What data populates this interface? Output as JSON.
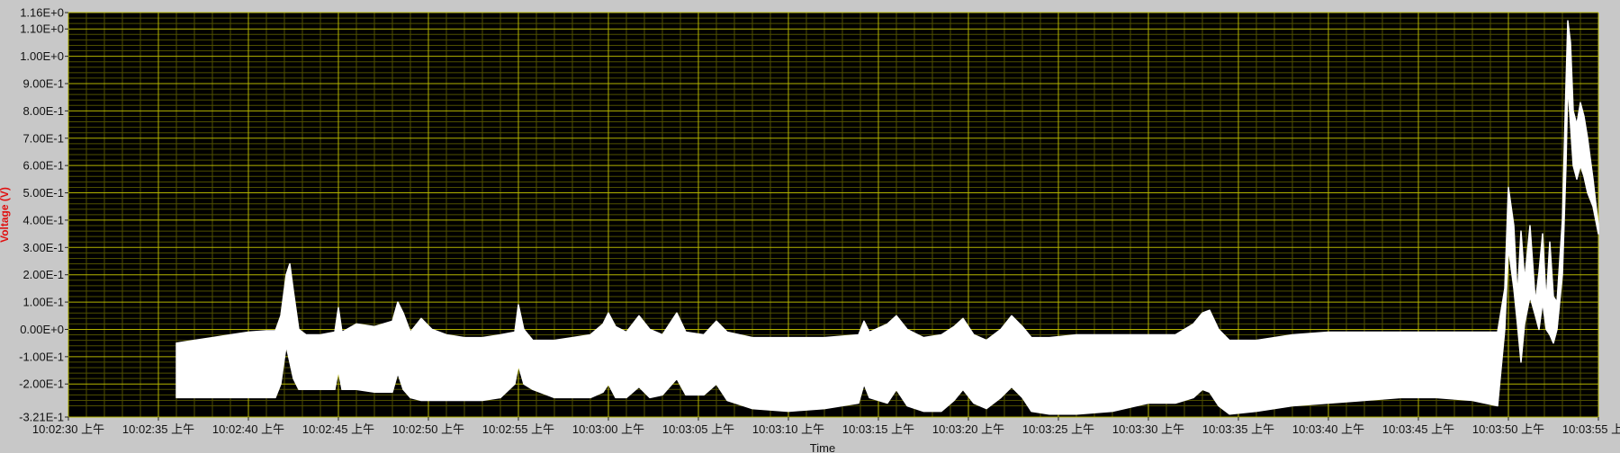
{
  "chart_data": {
    "type": "line",
    "title": "",
    "xlabel": "Time",
    "ylabel": "Voltage (V)",
    "ylim": [
      -0.321,
      1.16
    ],
    "xlim_seconds": [
      0,
      85
    ],
    "grid": true,
    "colors": {
      "plot_background": "#000000",
      "major_grid": "#b4b400",
      "minor_grid": "#4f4f00",
      "series": "#ffffff",
      "frame": "#c8c8c8",
      "ylabel": "#e01010"
    },
    "y_ticks": [
      {
        "value": 1.16,
        "label": "1.16E+0"
      },
      {
        "value": 1.1,
        "label": "1.10E+0"
      },
      {
        "value": 1.0,
        "label": "1.00E+0"
      },
      {
        "value": 0.9,
        "label": "9.00E-1"
      },
      {
        "value": 0.8,
        "label": "8.00E-1"
      },
      {
        "value": 0.7,
        "label": "7.00E-1"
      },
      {
        "value": 0.6,
        "label": "6.00E-1"
      },
      {
        "value": 0.5,
        "label": "5.00E-1"
      },
      {
        "value": 0.4,
        "label": "4.00E-1"
      },
      {
        "value": 0.3,
        "label": "3.00E-1"
      },
      {
        "value": 0.2,
        "label": "2.00E-1"
      },
      {
        "value": 0.1,
        "label": "1.00E-1"
      },
      {
        "value": 0.0,
        "label": "0.00E+0"
      },
      {
        "value": -0.1,
        "label": "-1.00E-1"
      },
      {
        "value": -0.2,
        "label": "-2.00E-1"
      },
      {
        "value": -0.321,
        "label": "-3.21E-1"
      }
    ],
    "x_ticks": [
      {
        "t": 0,
        "label": "10:02:30 上午"
      },
      {
        "t": 5,
        "label": "10:02:35 上午"
      },
      {
        "t": 10,
        "label": "10:02:40 上午"
      },
      {
        "t": 15,
        "label": "10:02:45 上午"
      },
      {
        "t": 20,
        "label": "10:02:50 上午"
      },
      {
        "t": 25,
        "label": "10:02:55 上午"
      },
      {
        "t": 30,
        "label": "10:03:00 上午"
      },
      {
        "t": 35,
        "label": "10:03:05 上午"
      },
      {
        "t": 40,
        "label": "10:03:10 上午"
      },
      {
        "t": 45,
        "label": "10:03:15 上午"
      },
      {
        "t": 50,
        "label": "10:03:20 上午"
      },
      {
        "t": 55,
        "label": "10:03:25 上午"
      },
      {
        "t": 60,
        "label": "10:03:30 上午"
      },
      {
        "t": 65,
        "label": "10:03:35 上午"
      },
      {
        "t": 70,
        "label": "10:03:40 上午"
      },
      {
        "t": 75,
        "label": "10:03:45 上午"
      },
      {
        "t": 80,
        "label": "10:03:50 上午"
      },
      {
        "t": 85,
        "label": "10:03:55 上午"
      }
    ],
    "series": [
      {
        "upper": [
          [
            6.0,
            -0.05
          ],
          [
            7.0,
            -0.04
          ],
          [
            8.0,
            -0.03
          ],
          [
            9.0,
            -0.02
          ],
          [
            10.0,
            -0.01
          ],
          [
            11.0,
            -0.005
          ],
          [
            11.5,
            -0.005
          ],
          [
            11.8,
            0.05
          ],
          [
            12.1,
            0.2
          ],
          [
            12.3,
            0.24
          ],
          [
            12.5,
            0.14
          ],
          [
            12.8,
            0.0
          ],
          [
            13.2,
            -0.02
          ],
          [
            14.0,
            -0.02
          ],
          [
            14.8,
            -0.01
          ],
          [
            15.0,
            0.08
          ],
          [
            15.2,
            -0.01
          ],
          [
            16.0,
            0.02
          ],
          [
            17.0,
            0.01
          ],
          [
            18.0,
            0.03
          ],
          [
            18.3,
            0.1
          ],
          [
            18.6,
            0.06
          ],
          [
            19.0,
            -0.01
          ],
          [
            19.6,
            0.04
          ],
          [
            20.2,
            0.0
          ],
          [
            21.0,
            -0.02
          ],
          [
            22.0,
            -0.03
          ],
          [
            23.0,
            -0.03
          ],
          [
            24.0,
            -0.02
          ],
          [
            24.8,
            -0.01
          ],
          [
            25.0,
            0.09
          ],
          [
            25.3,
            0.0
          ],
          [
            25.8,
            -0.04
          ],
          [
            27.0,
            -0.04
          ],
          [
            28.0,
            -0.03
          ],
          [
            29.0,
            -0.02
          ],
          [
            29.7,
            0.02
          ],
          [
            30.0,
            0.06
          ],
          [
            30.4,
            0.01
          ],
          [
            31.0,
            -0.01
          ],
          [
            31.7,
            0.05
          ],
          [
            32.3,
            0.0
          ],
          [
            33.0,
            -0.02
          ],
          [
            33.8,
            0.06
          ],
          [
            34.3,
            -0.01
          ],
          [
            35.3,
            -0.02
          ],
          [
            36.0,
            0.03
          ],
          [
            36.6,
            -0.01
          ],
          [
            38.0,
            -0.03
          ],
          [
            40.0,
            -0.03
          ],
          [
            42.0,
            -0.03
          ],
          [
            43.9,
            -0.02
          ],
          [
            44.2,
            0.03
          ],
          [
            44.5,
            -0.01
          ],
          [
            45.5,
            0.02
          ],
          [
            46.0,
            0.05
          ],
          [
            46.6,
            0.0
          ],
          [
            47.5,
            -0.03
          ],
          [
            48.5,
            -0.02
          ],
          [
            49.2,
            0.01
          ],
          [
            49.7,
            0.04
          ],
          [
            50.3,
            -0.02
          ],
          [
            51.0,
            -0.04
          ],
          [
            51.8,
            0.0
          ],
          [
            52.4,
            0.05
          ],
          [
            53.0,
            0.01
          ],
          [
            53.5,
            -0.03
          ],
          [
            54.5,
            -0.03
          ],
          [
            56.0,
            -0.02
          ],
          [
            58.0,
            -0.02
          ],
          [
            60.0,
            -0.02
          ],
          [
            61.5,
            -0.02
          ],
          [
            62.5,
            0.02
          ],
          [
            63.0,
            0.06
          ],
          [
            63.4,
            0.07
          ],
          [
            63.9,
            0.0
          ],
          [
            64.5,
            -0.04
          ],
          [
            66.0,
            -0.04
          ],
          [
            68.0,
            -0.02
          ],
          [
            70.0,
            -0.01
          ],
          [
            72.0,
            -0.01
          ],
          [
            74.0,
            -0.01
          ],
          [
            76.0,
            -0.01
          ],
          [
            78.0,
            -0.01
          ],
          [
            79.4,
            -0.01
          ],
          [
            79.8,
            0.15
          ],
          [
            80.0,
            0.52
          ],
          [
            80.3,
            0.38
          ],
          [
            80.5,
            0.12
          ],
          [
            80.7,
            0.36
          ],
          [
            80.9,
            0.18
          ],
          [
            81.2,
            0.38
          ],
          [
            81.5,
            0.1
          ],
          [
            81.7,
            0.21
          ],
          [
            81.9,
            0.35
          ],
          [
            82.1,
            0.1
          ],
          [
            82.3,
            0.32
          ],
          [
            82.5,
            0.12
          ],
          [
            82.7,
            0.1
          ],
          [
            83.0,
            0.4
          ],
          [
            83.2,
            0.9
          ],
          [
            83.3,
            1.13
          ],
          [
            83.45,
            1.05
          ],
          [
            83.6,
            0.8
          ],
          [
            83.8,
            0.75
          ],
          [
            84.0,
            0.83
          ],
          [
            84.2,
            0.78
          ],
          [
            84.4,
            0.7
          ],
          [
            84.7,
            0.55
          ],
          [
            85.0,
            0.38
          ]
        ],
        "lower": [
          [
            6.0,
            -0.25
          ],
          [
            7.0,
            -0.25
          ],
          [
            8.0,
            -0.25
          ],
          [
            9.0,
            -0.25
          ],
          [
            10.0,
            -0.25
          ],
          [
            11.0,
            -0.25
          ],
          [
            11.5,
            -0.25
          ],
          [
            11.8,
            -0.2
          ],
          [
            12.1,
            -0.06
          ],
          [
            12.3,
            -0.12
          ],
          [
            12.5,
            -0.18
          ],
          [
            12.8,
            -0.22
          ],
          [
            13.2,
            -0.22
          ],
          [
            14.0,
            -0.22
          ],
          [
            14.8,
            -0.22
          ],
          [
            15.0,
            -0.15
          ],
          [
            15.2,
            -0.22
          ],
          [
            16.0,
            -0.22
          ],
          [
            17.0,
            -0.23
          ],
          [
            18.0,
            -0.23
          ],
          [
            18.3,
            -0.16
          ],
          [
            18.6,
            -0.22
          ],
          [
            19.0,
            -0.25
          ],
          [
            19.6,
            -0.26
          ],
          [
            20.2,
            -0.26
          ],
          [
            21.0,
            -0.26
          ],
          [
            22.0,
            -0.26
          ],
          [
            23.0,
            -0.26
          ],
          [
            24.0,
            -0.25
          ],
          [
            24.8,
            -0.2
          ],
          [
            25.0,
            -0.13
          ],
          [
            25.3,
            -0.2
          ],
          [
            25.8,
            -0.22
          ],
          [
            27.0,
            -0.25
          ],
          [
            28.0,
            -0.25
          ],
          [
            29.0,
            -0.25
          ],
          [
            29.7,
            -0.23
          ],
          [
            30.0,
            -0.2
          ],
          [
            30.4,
            -0.25
          ],
          [
            31.0,
            -0.25
          ],
          [
            31.7,
            -0.21
          ],
          [
            32.3,
            -0.25
          ],
          [
            33.0,
            -0.24
          ],
          [
            33.8,
            -0.18
          ],
          [
            34.3,
            -0.24
          ],
          [
            35.3,
            -0.24
          ],
          [
            36.0,
            -0.2
          ],
          [
            36.6,
            -0.26
          ],
          [
            38.0,
            -0.29
          ],
          [
            40.0,
            -0.3
          ],
          [
            42.0,
            -0.29
          ],
          [
            43.9,
            -0.27
          ],
          [
            44.2,
            -0.2
          ],
          [
            44.5,
            -0.25
          ],
          [
            45.5,
            -0.27
          ],
          [
            46.0,
            -0.22
          ],
          [
            46.6,
            -0.28
          ],
          [
            47.5,
            -0.3
          ],
          [
            48.5,
            -0.3
          ],
          [
            49.2,
            -0.26
          ],
          [
            49.7,
            -0.22
          ],
          [
            50.3,
            -0.27
          ],
          [
            51.0,
            -0.29
          ],
          [
            51.8,
            -0.25
          ],
          [
            52.4,
            -0.21
          ],
          [
            53.0,
            -0.25
          ],
          [
            53.5,
            -0.3
          ],
          [
            54.5,
            -0.31
          ],
          [
            56.0,
            -0.31
          ],
          [
            58.0,
            -0.3
          ],
          [
            60.0,
            -0.27
          ],
          [
            61.5,
            -0.27
          ],
          [
            62.5,
            -0.25
          ],
          [
            63.0,
            -0.22
          ],
          [
            63.4,
            -0.23
          ],
          [
            63.9,
            -0.28
          ],
          [
            64.5,
            -0.31
          ],
          [
            66.0,
            -0.3
          ],
          [
            68.0,
            -0.28
          ],
          [
            70.0,
            -0.27
          ],
          [
            72.0,
            -0.26
          ],
          [
            74.0,
            -0.25
          ],
          [
            76.0,
            -0.25
          ],
          [
            78.0,
            -0.26
          ],
          [
            79.4,
            -0.28
          ],
          [
            79.8,
            0.0
          ],
          [
            80.0,
            0.3
          ],
          [
            80.3,
            0.15
          ],
          [
            80.5,
            0.02
          ],
          [
            80.7,
            -0.12
          ],
          [
            80.9,
            0.02
          ],
          [
            81.2,
            0.12
          ],
          [
            81.5,
            0.05
          ],
          [
            81.7,
            0.0
          ],
          [
            81.9,
            0.1
          ],
          [
            82.1,
            0.0
          ],
          [
            82.3,
            -0.02
          ],
          [
            82.5,
            -0.05
          ],
          [
            82.7,
            0.0
          ],
          [
            83.0,
            0.2
          ],
          [
            83.2,
            0.6
          ],
          [
            83.3,
            0.9
          ],
          [
            83.45,
            0.75
          ],
          [
            83.6,
            0.6
          ],
          [
            83.8,
            0.55
          ],
          [
            84.0,
            0.6
          ],
          [
            84.2,
            0.56
          ],
          [
            84.4,
            0.5
          ],
          [
            84.7,
            0.45
          ],
          [
            85.0,
            0.35
          ]
        ]
      }
    ]
  }
}
